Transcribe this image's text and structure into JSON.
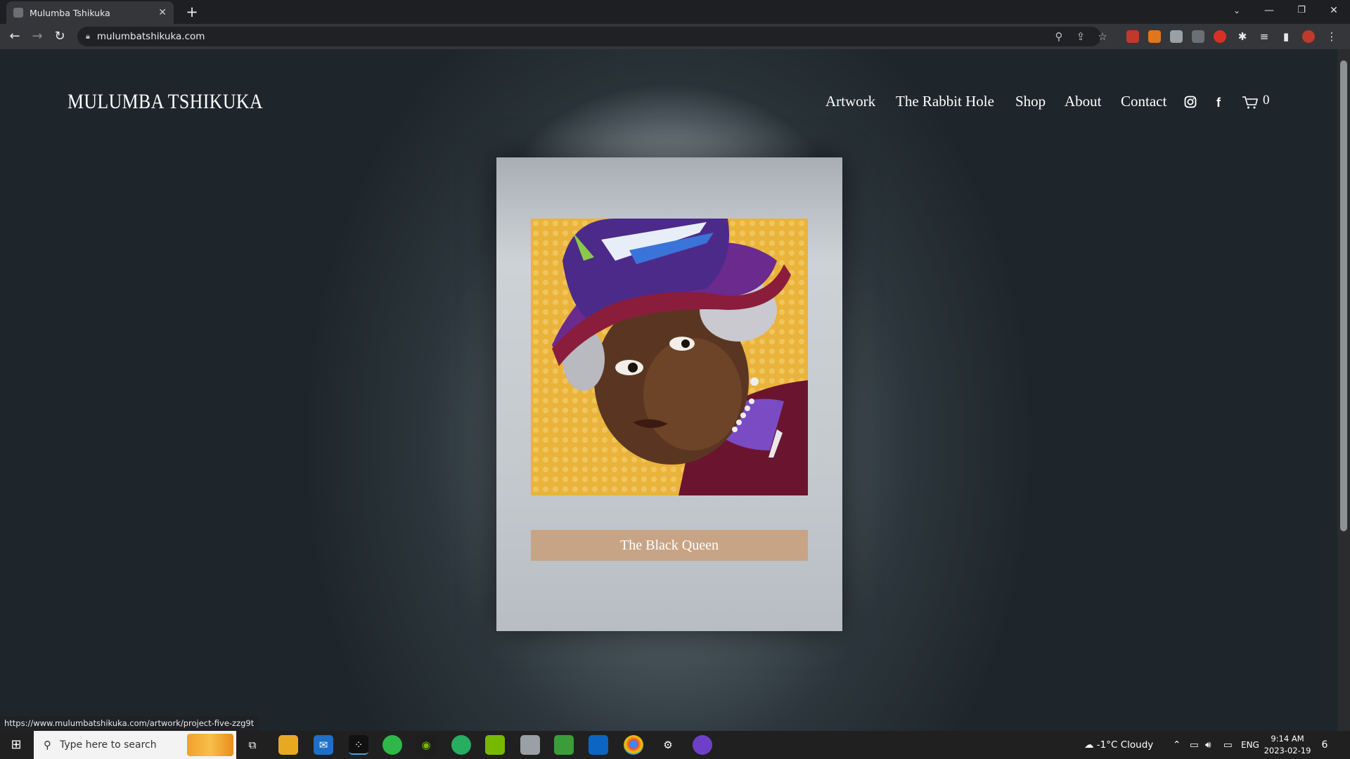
{
  "browser": {
    "tab_title": "Mulumba Tshikuka",
    "new_tab": "+",
    "url": "mulumbatshikuka.com",
    "status_url": "https://www.mulumbatshikuka.com/artwork/project-five-zzg9t"
  },
  "site": {
    "logo": "MULUMBA TSHIKUKA",
    "nav": [
      "Artwork",
      "The Rabbit Hole",
      "Shop",
      "About",
      "Contact"
    ],
    "cart_count": "0"
  },
  "artwork": {
    "caption": "The Black Queen"
  },
  "taskbar": {
    "search_placeholder": "Type here to search",
    "weather": "-1°C  Cloudy",
    "language": "ENG",
    "time": "9:14 AM",
    "date": "2023-02-19",
    "notification_count": "6"
  },
  "colors": {
    "caption_bg": "#c8a486",
    "card_bg": "#c6ccd0",
    "page_bg": "#1e262b"
  }
}
